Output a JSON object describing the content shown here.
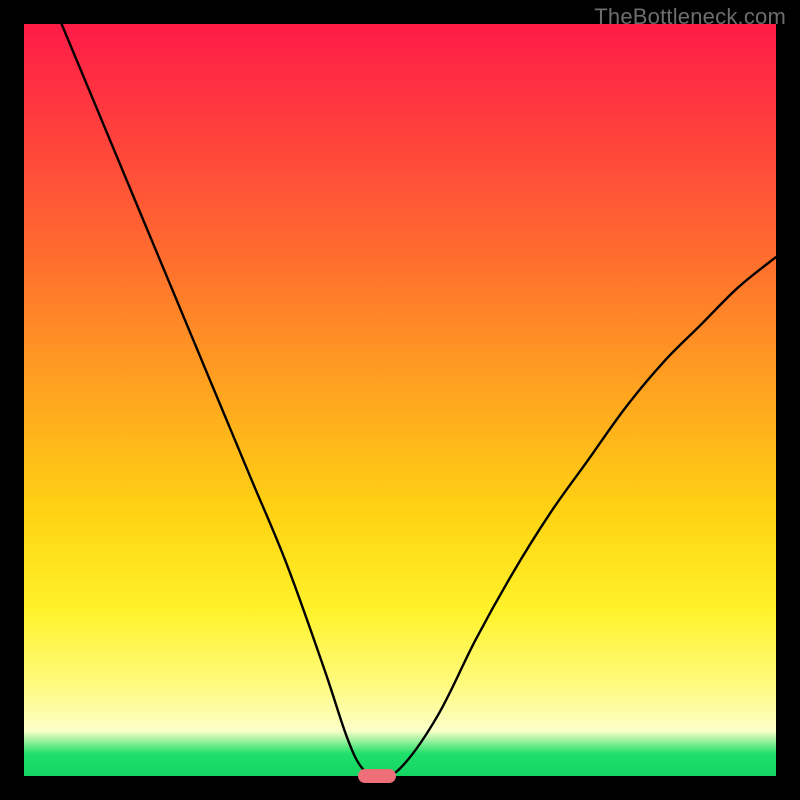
{
  "watermark": "TheBottleneck.com",
  "chart_data": {
    "type": "line",
    "title": "",
    "xlabel": "",
    "ylabel": "",
    "xlim": [
      0,
      100
    ],
    "ylim": [
      0,
      100
    ],
    "grid": false,
    "legend": false,
    "series": [
      {
        "name": "bottleneck-curve",
        "x": [
          5,
          10,
          15,
          20,
          25,
          30,
          35,
          40,
          43,
          45,
          47,
          50,
          55,
          60,
          65,
          70,
          75,
          80,
          85,
          90,
          95,
          100
        ],
        "y": [
          100,
          88,
          76,
          64,
          52,
          40,
          28,
          14,
          5,
          1,
          0,
          1,
          8,
          18,
          27,
          35,
          42,
          49,
          55,
          60,
          65,
          69
        ]
      }
    ],
    "annotations": [
      {
        "name": "optimal-marker",
        "x": 47,
        "y": 0,
        "shape": "pill",
        "color": "#ef6f78"
      }
    ],
    "background_gradient": {
      "direction": "top-to-bottom",
      "stops": [
        {
          "pos": 0.0,
          "color": "#ff1c47"
        },
        {
          "pos": 0.3,
          "color": "#ff6a2f"
        },
        {
          "pos": 0.65,
          "color": "#ffd313"
        },
        {
          "pos": 0.88,
          "color": "#fffb80"
        },
        {
          "pos": 0.97,
          "color": "#1fe06a"
        },
        {
          "pos": 1.0,
          "color": "#14d564"
        }
      ]
    }
  }
}
